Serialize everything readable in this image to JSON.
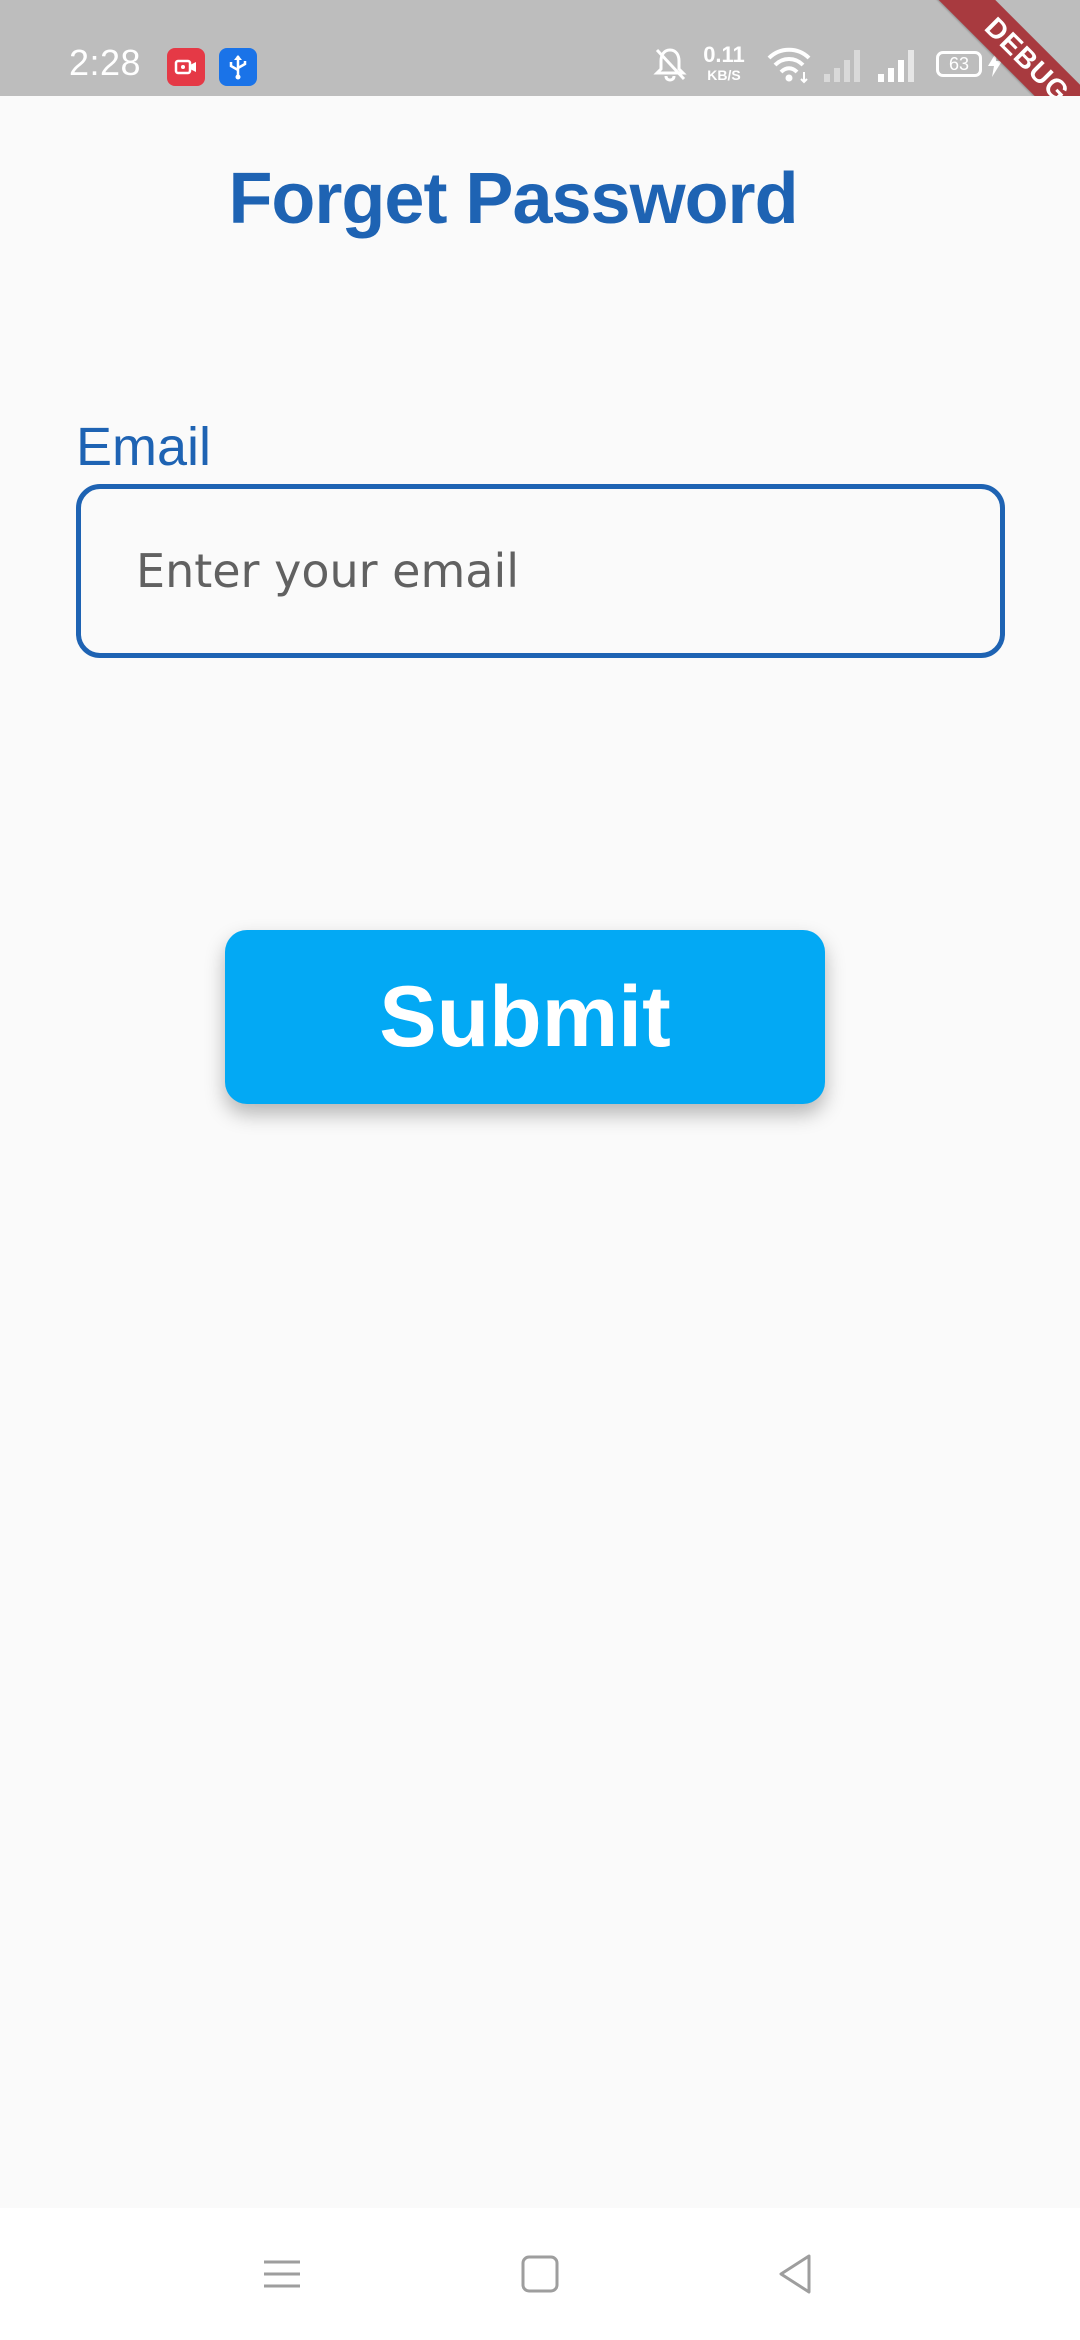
{
  "status_bar": {
    "time": "2:28",
    "speed_value": "0.11",
    "speed_unit": "KB/S",
    "battery": "63",
    "debug_label": "DEBUG",
    "icons": [
      "screen-recorder-icon",
      "usb-icon",
      "bell-off-icon",
      "wifi-icon",
      "signal-weak-icon",
      "signal-icon",
      "battery-icon",
      "charging-bolt-icon"
    ]
  },
  "page": {
    "title": "Forget Password",
    "email_label": "Email",
    "email_placeholder": "Enter your email",
    "email_value": "",
    "submit_label": "Submit"
  },
  "nav_bar": {
    "icons": [
      "menu-icon",
      "home-icon",
      "back-icon"
    ]
  },
  "colors": {
    "primary": "#1e63b3",
    "button": "#03a9f4",
    "background": "#fafafa",
    "status_bar": "#bdbdbd",
    "debug_ribbon": "#a83a3f"
  }
}
